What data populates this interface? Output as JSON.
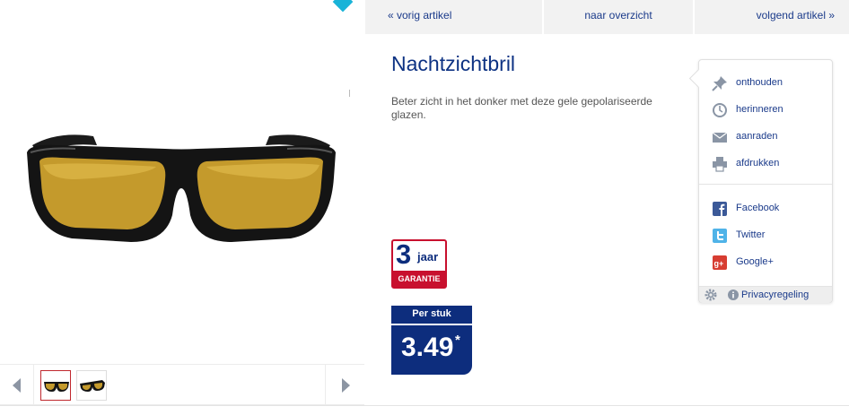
{
  "nav": {
    "prev": "« vorig artikel",
    "overview": "naar overzicht",
    "next": "volgend artikel »"
  },
  "product": {
    "title": "Nachtzichtbril",
    "description": "Beter zicht in het donker met deze gele gepolariseerde glazen."
  },
  "badge": {
    "number": "3",
    "unit": "jaar",
    "label": "GARANTIE"
  },
  "price": {
    "label": "Per stuk",
    "value": "3.49",
    "asterisk": "*"
  },
  "actions": [
    {
      "label": "onthouden",
      "icon": "pin-icon"
    },
    {
      "label": "herinneren",
      "icon": "clock-icon"
    },
    {
      "label": "aanraden",
      "icon": "envelope-icon"
    },
    {
      "label": "afdrukken",
      "icon": "printer-icon"
    }
  ],
  "social": [
    {
      "label": "Facebook",
      "icon": "facebook-icon",
      "color": "#3b5998"
    },
    {
      "label": "Twitter",
      "icon": "twitter-icon",
      "color": "#4fb3e8"
    },
    {
      "label": "Google+",
      "icon": "google-plus-icon",
      "color": "#d73d32"
    }
  ],
  "footer": {
    "privacy": "Privacyregeling"
  },
  "colors": {
    "brand_blue": "#0d2d7d",
    "link_blue": "#1a3a8a",
    "guarantee_red": "#c8102e",
    "accent_cyan": "#19b3d8"
  }
}
